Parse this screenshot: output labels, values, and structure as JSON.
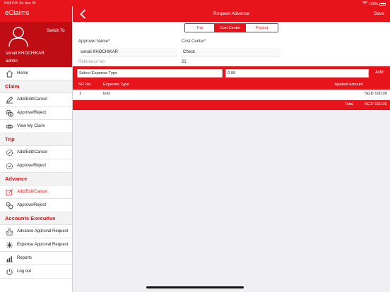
{
  "status_bar": {
    "time": "5:04 PM",
    "date": "Fri Nov 30",
    "battery": "100%"
  },
  "sidebar": {
    "app_title": "eClaims",
    "profile": {
      "switch_label": "Switch To",
      "name": "sonali KHOCHIKAR",
      "role": "admin"
    },
    "home": "Home",
    "sections": {
      "claim": "Claim",
      "trip": "Trip",
      "advance": "Advance",
      "accounts": "Accounts Executive"
    },
    "claim_items": [
      "Add/Edit/Cancel",
      "Approve/Reject",
      "View My Claim"
    ],
    "trip_items": [
      "Add/Edit/Cancel",
      "Approve/Reject"
    ],
    "advance_items": [
      "Add/Edit/Cancel",
      "Approve/Reject"
    ],
    "accounts_items": [
      "Advance Approval Request",
      "Expense Approval Request"
    ],
    "reports": "Reports",
    "logout": "Log out"
  },
  "header": {
    "title": "Request Advance",
    "save": "Save"
  },
  "tabs": [
    "Trip",
    "Cost Center",
    "Project"
  ],
  "form": {
    "approver_label": "Approver Name*",
    "approver_value": "sonali KHOCHIKAR",
    "cost_center_label": "Cost Center*",
    "cost_center_value": "Check",
    "reference_label": "Reference No",
    "reference_value": "21"
  },
  "expense_entry": {
    "type_value": "Select Expense Type",
    "amount_value": "0.00",
    "add_label": "Add"
  },
  "table": {
    "headers": [
      "SR No.",
      "Expense Type",
      "Applied Amount"
    ],
    "rows": [
      {
        "sr": "1",
        "type": "test",
        "amount": "SGD 100.00"
      }
    ],
    "total_label": "Total",
    "total_value": "SGD 100.00"
  },
  "colors": {
    "brand": "#e8141c",
    "brand_dark": "#c00d14"
  }
}
